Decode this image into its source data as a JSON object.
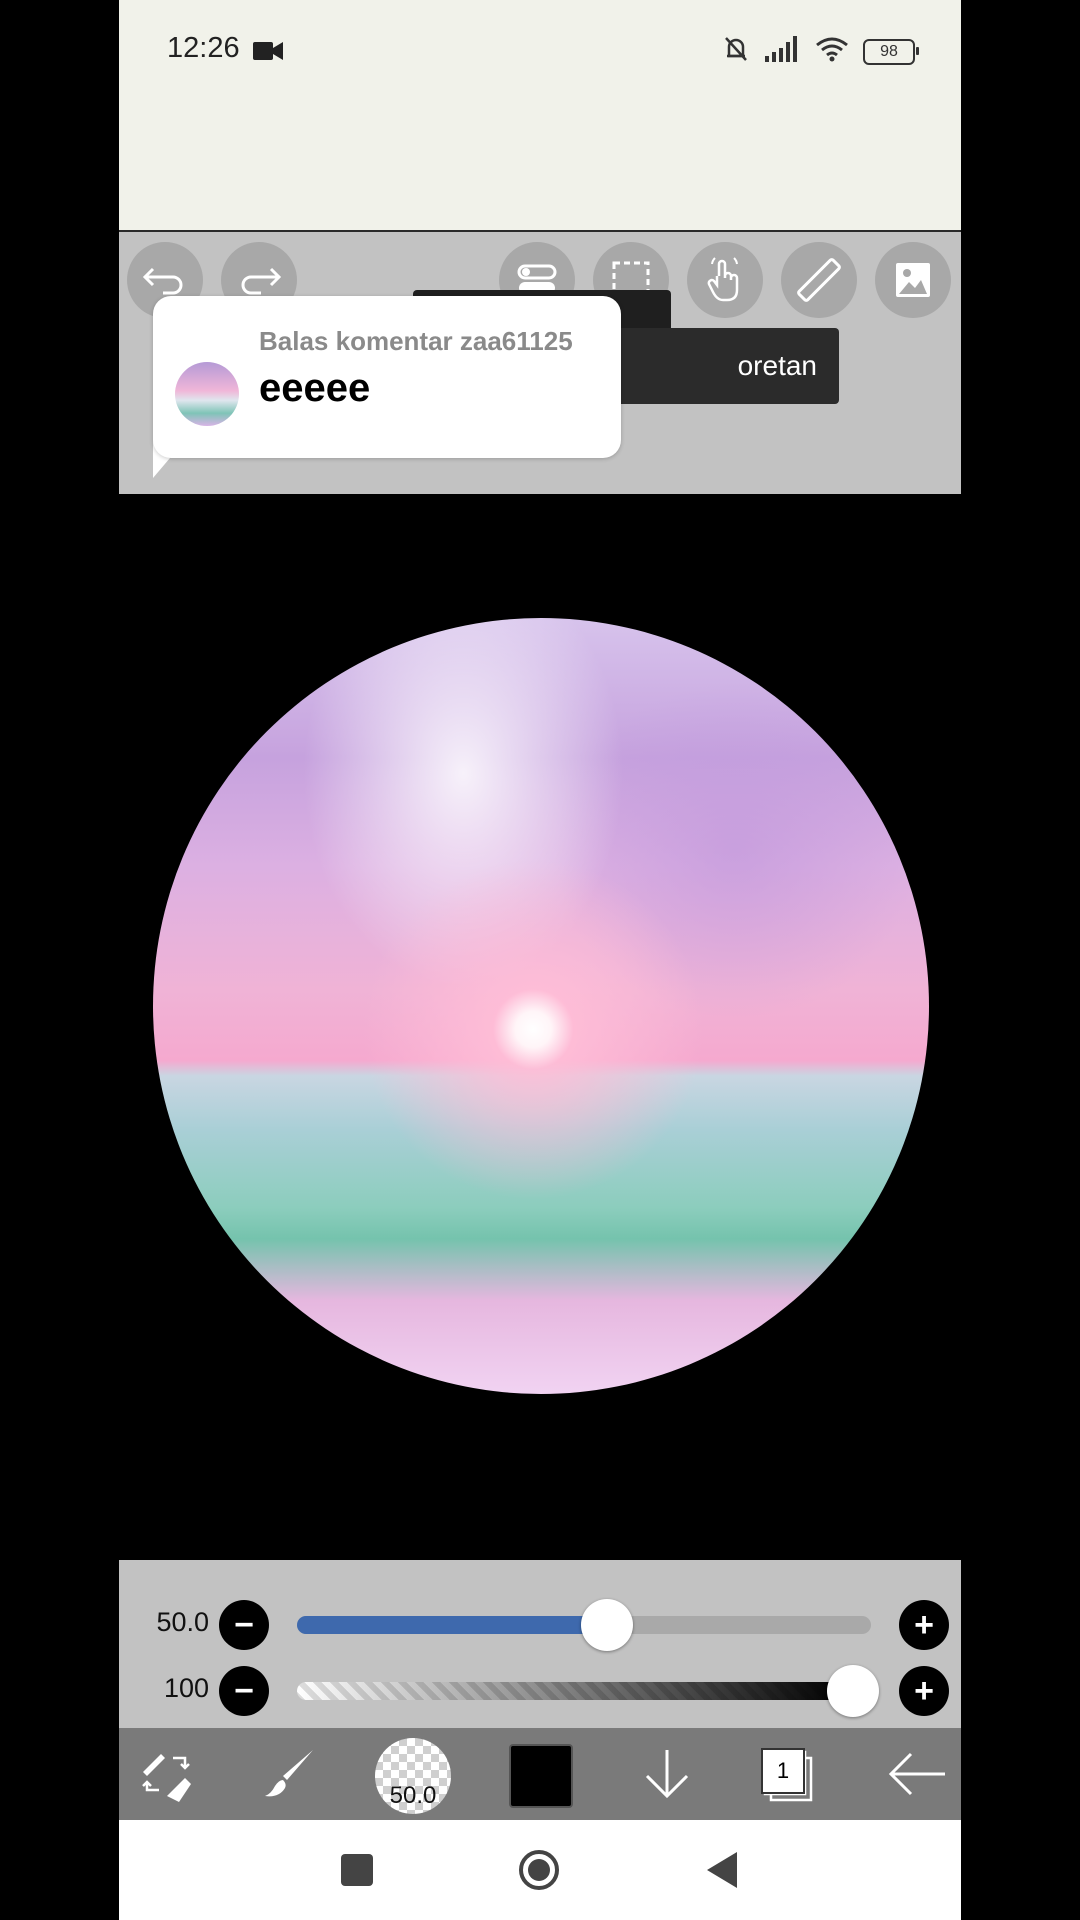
{
  "status_bar": {
    "time": "12:26",
    "battery": "98"
  },
  "toolbar": {
    "tooltip_text": "oretan",
    "comment_bubble": {
      "reply_label": "Balas komentar zaa61125",
      "message": "eeeee"
    }
  },
  "sliders": {
    "size_value": "50.0",
    "size_fraction": 0.54,
    "opacity_value": "100",
    "opacity_fraction": 1.0
  },
  "bottom_bar": {
    "brush_size_label": "50.0",
    "current_color": "#000000",
    "layer_count": "1"
  },
  "colors": {
    "slider_fill": "#3e69ad",
    "panel_bg": "#c2c2c2",
    "bottom_bar_bg": "#7a7a7a"
  }
}
